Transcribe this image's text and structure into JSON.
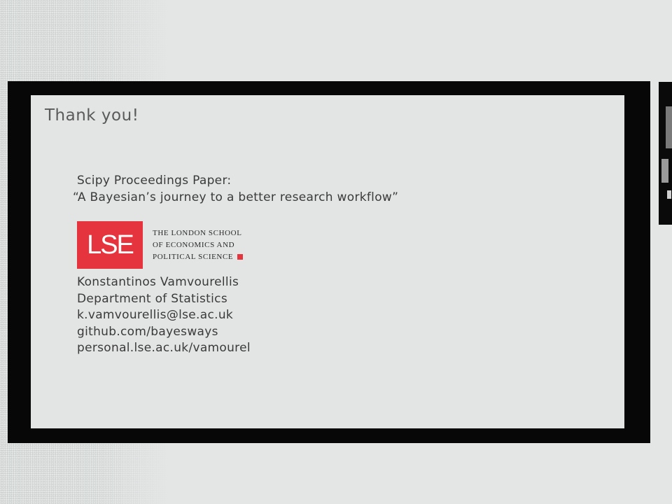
{
  "slide": {
    "title": "Thank you!",
    "paper_label": "Scipy Proceedings Paper:",
    "paper_title": "“A Bayesian’s journey to a better research workflow”",
    "logo": {
      "abbr": "LSE",
      "lines": [
        "The London School",
        "of Economics and",
        "Political Science"
      ],
      "brand_color": "#e5343d"
    },
    "contact": {
      "name": "Konstantinos Vamvourellis",
      "department": "Department of Statistics",
      "email": "k.vamvourellis@lse.ac.uk",
      "github": "github.com/bayesways",
      "website": "personal.lse.ac.uk/vamourel"
    }
  },
  "colors": {
    "background": "#e3e6e5",
    "frame": "#070707",
    "slide_bg": "#e3e5e4"
  }
}
